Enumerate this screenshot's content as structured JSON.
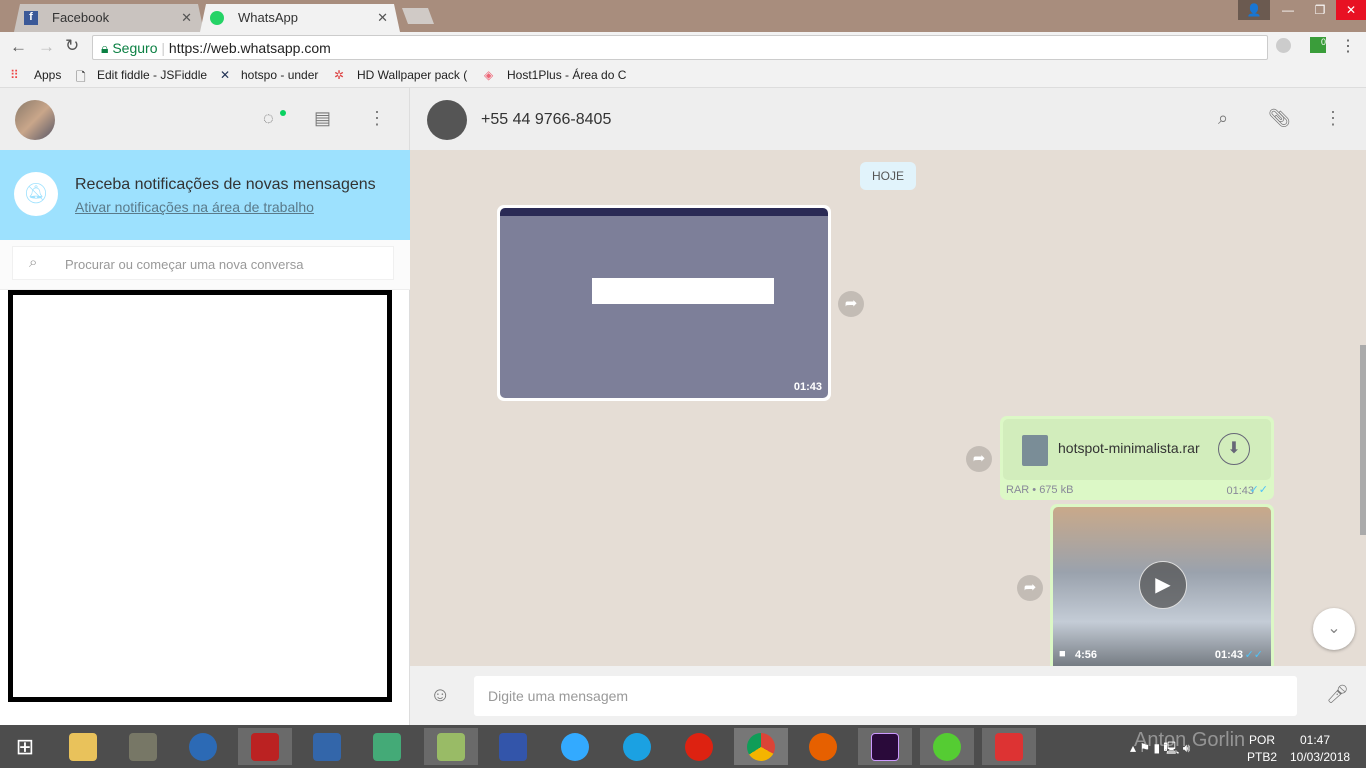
{
  "browser": {
    "tabs": [
      {
        "title": "Facebook"
      },
      {
        "title": "WhatsApp"
      }
    ],
    "secure_label": "Seguro",
    "url": "https://web.whatsapp.com",
    "bookmarks": [
      "Apps",
      "Edit fiddle - JSFiddle",
      "hotspo - under",
      "HD Wallpaper pack (",
      "Host1Plus - Área do C"
    ],
    "ext_badge": "0"
  },
  "sidebar": {
    "notification": {
      "title": "Receba notificações de novas mensagens",
      "link": "Ativar notificações na área de trabalho"
    },
    "search_placeholder": "Procurar ou começar uma nova conversa"
  },
  "chat": {
    "contact": "+55 44 9766-8405",
    "date_chip": "HOJE",
    "messages": [
      {
        "type": "video",
        "direction": "in",
        "time": "01:43"
      },
      {
        "type": "file",
        "direction": "out",
        "filename": "hotspot-minimalista.rar",
        "meta": "RAR • 675 kB",
        "time": "01:43",
        "status": "read"
      },
      {
        "type": "video",
        "direction": "out",
        "duration": "4:56",
        "time": "01:43",
        "status": "read"
      }
    ],
    "input_placeholder": "Digite uma mensagem",
    "colors": {
      "bg": "#e5ddd5",
      "outgoing": "#dcf8c6",
      "banner": "#9de1fe",
      "ticks": "#4fc3f7"
    }
  },
  "taskbar": {
    "watermark": "Anton Gorlin",
    "lang": "POR",
    "layout": "PTB2",
    "time": "01:47",
    "date": "10/03/2018"
  }
}
